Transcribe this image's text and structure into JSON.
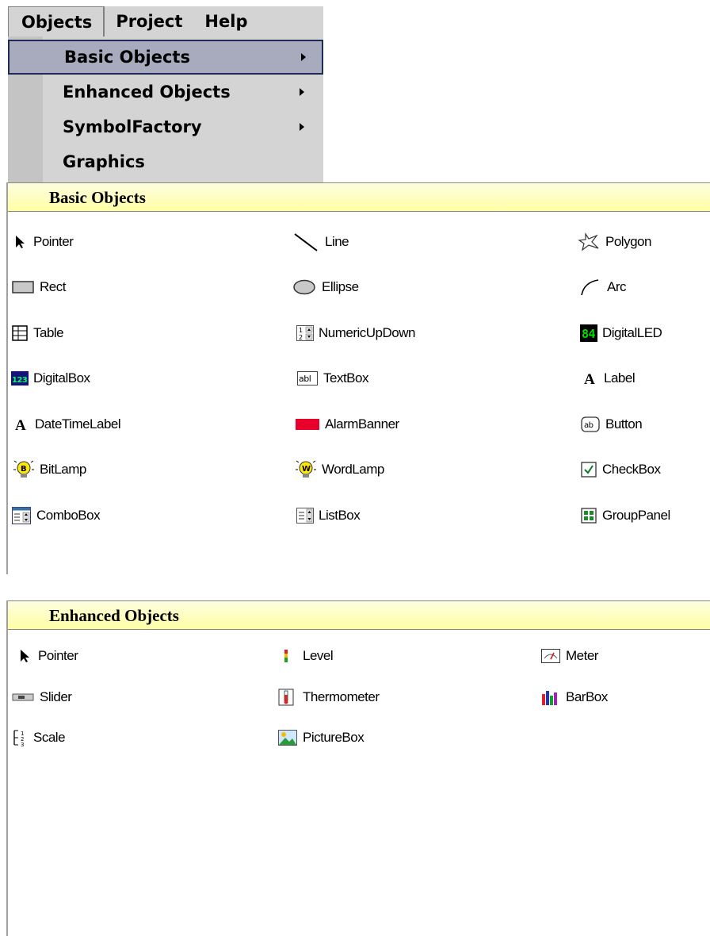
{
  "menubar": {
    "objects": "Objects",
    "project": "Project",
    "help": "Help"
  },
  "menu": {
    "items": [
      {
        "label": "Basic Objects",
        "submenu": true
      },
      {
        "label": "Enhanced Objects",
        "submenu": true
      },
      {
        "label": "SymbolFactory",
        "submenu": true
      },
      {
        "label": "Graphics",
        "submenu": false
      }
    ]
  },
  "basic": {
    "title": "Basic Objects",
    "items": {
      "pointer": "Pointer",
      "line": "Line",
      "polygon": "Polygon",
      "rect": "Rect",
      "ellipse": "Ellipse",
      "arc": "Arc",
      "table": "Table",
      "numeric": "NumericUpDown",
      "digitalled": "DigitalLED",
      "digitalbox": "DigitalBox",
      "textbox": "TextBox",
      "label": "Label",
      "datetime": "DateTimeLabel",
      "alarm": "AlarmBanner",
      "button": "Button",
      "bitlamp": "BitLamp",
      "wordlamp": "WordLamp",
      "checkbox": "CheckBox",
      "combobox": "ComboBox",
      "listbox": "ListBox",
      "grouppanel": "GroupPanel"
    }
  },
  "enhanced": {
    "title": "Enhanced Objects",
    "items": {
      "pointer": "Pointer",
      "level": "Level",
      "meter": "Meter",
      "slider": "Slider",
      "thermometer": "Thermometer",
      "barbox": "BarBox",
      "scale": "Scale",
      "picturebox": "PictureBox"
    }
  },
  "icon_glyphs": {
    "digitalled": "84",
    "digitalbox": "123",
    "textbox": "abl",
    "button": "ab",
    "label_glyph": "A",
    "bitlamp": "B",
    "wordlamp": "W"
  },
  "colors": {
    "header_bg": "#ffffa6",
    "menu_bg": "#d4d4d4",
    "highlight": "#a8aabd",
    "alarm_red": "#e8002a",
    "led_green": "#00e000"
  }
}
